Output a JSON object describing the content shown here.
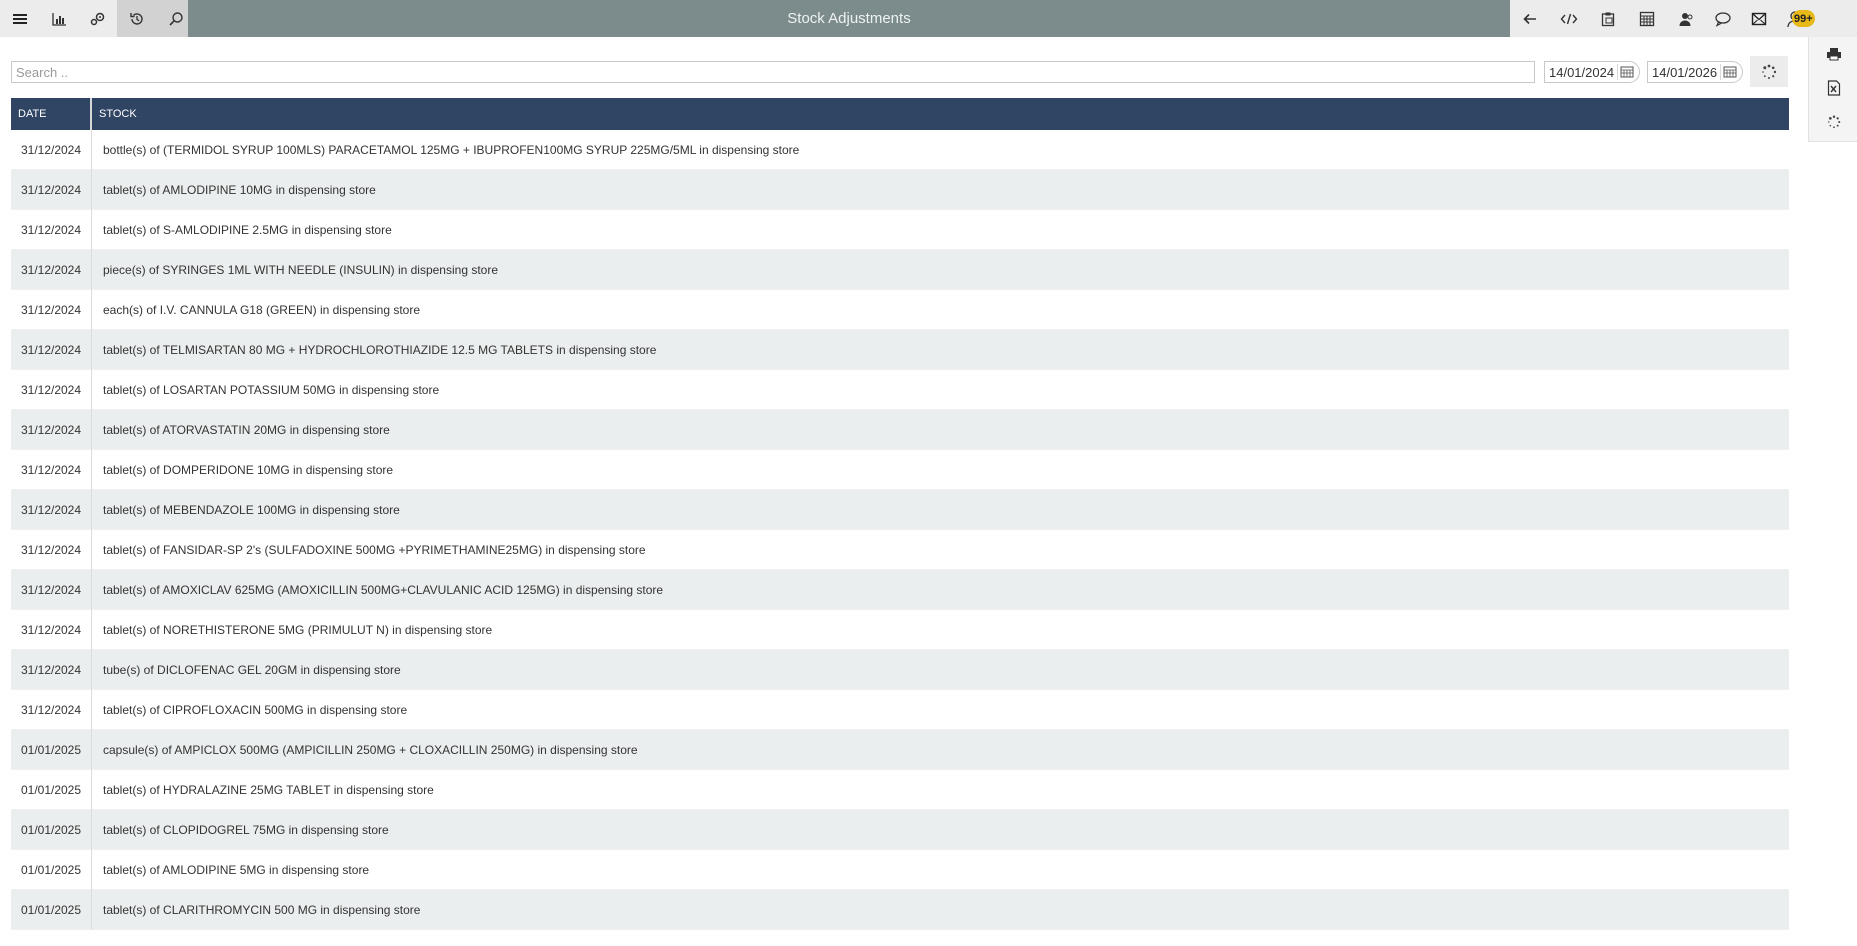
{
  "header": {
    "title": "Stock Adjustments",
    "notification_count": "99+"
  },
  "filters": {
    "search_placeholder": "Search ..",
    "date_from": "14/01/2024",
    "date_to": "14/01/2026"
  },
  "table": {
    "columns": [
      "DATE",
      "STOCK"
    ],
    "rows": [
      {
        "date": "31/12/2024",
        "stock": "bottle(s) of (TERMIDOL SYRUP 100MLS) PARACETAMOL 125MG + IBUPROFEN100MG SYRUP 225MG/5ML in dispensing store"
      },
      {
        "date": "31/12/2024",
        "stock": "tablet(s) of AMLODIPINE 10MG in dispensing store"
      },
      {
        "date": "31/12/2024",
        "stock": "tablet(s) of S-AMLODIPINE 2.5MG in dispensing store"
      },
      {
        "date": "31/12/2024",
        "stock": "piece(s) of SYRINGES 1ML WITH NEEDLE (INSULIN) in dispensing store"
      },
      {
        "date": "31/12/2024",
        "stock": "each(s) of I.V. CANNULA G18 (GREEN) in dispensing store"
      },
      {
        "date": "31/12/2024",
        "stock": "tablet(s) of TELMISARTAN 80 MG + HYDROCHLOROTHIAZIDE 12.5 MG TABLETS in dispensing store"
      },
      {
        "date": "31/12/2024",
        "stock": "tablet(s) of LOSARTAN POTASSIUM 50MG in dispensing store"
      },
      {
        "date": "31/12/2024",
        "stock": "tablet(s) of ATORVASTATIN 20MG in dispensing store"
      },
      {
        "date": "31/12/2024",
        "stock": "tablet(s) of DOMPERIDONE 10MG in dispensing store"
      },
      {
        "date": "31/12/2024",
        "stock": "tablet(s) of MEBENDAZOLE 100MG in dispensing store"
      },
      {
        "date": "31/12/2024",
        "stock": "tablet(s) of FANSIDAR-SP 2's (SULFADOXINE 500MG +PYRIMETHAMINE25MG) in dispensing store"
      },
      {
        "date": "31/12/2024",
        "stock": "tablet(s) of AMOXICLAV 625MG (AMOXICILLIN 500MG+CLAVULANIC ACID 125MG) in dispensing store"
      },
      {
        "date": "31/12/2024",
        "stock": "tablet(s) of NORETHISTERONE 5MG (PRIMULUT N) in dispensing store"
      },
      {
        "date": "31/12/2024",
        "stock": "tube(s) of DICLOFENAC GEL 20GM in dispensing store"
      },
      {
        "date": "31/12/2024",
        "stock": "tablet(s) of CIPROFLOXACIN 500MG in dispensing store"
      },
      {
        "date": "01/01/2025",
        "stock": "capsule(s) of AMPICLOX 500MG (AMPICILLIN 250MG + CLOXACILLIN 250MG) in dispensing store"
      },
      {
        "date": "01/01/2025",
        "stock": "tablet(s) of HYDRALAZINE 25MG TABLET in dispensing store"
      },
      {
        "date": "01/01/2025",
        "stock": "tablet(s) of CLOPIDOGREL 75MG in dispensing store"
      },
      {
        "date": "01/01/2025",
        "stock": "tablet(s) of AMLODIPINE 5MG in dispensing store"
      },
      {
        "date": "01/01/2025",
        "stock": "tablet(s) of CLARITHROMYCIN 500 MG in dispensing store"
      }
    ]
  }
}
